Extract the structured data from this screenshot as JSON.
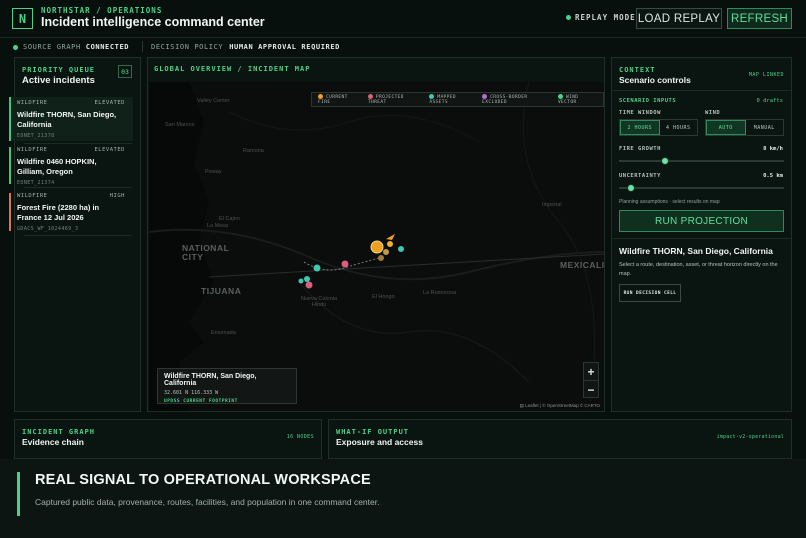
{
  "header": {
    "logo": "N",
    "kicker": "NORTHSTAR / OPERATIONS",
    "title": "Incident intelligence command center",
    "replay_mode": "REPLAY MODE",
    "load_replay": "LOAD REPLAY",
    "refresh": "REFRESH"
  },
  "status": {
    "source_label": "SOURCE GRAPH",
    "source_value": "CONNECTED",
    "policy_label": "DECISION POLICY",
    "policy_value": "HUMAN APPROVAL REQUIRED"
  },
  "queue": {
    "kicker": "PRIORITY QUEUE",
    "title": "Active incidents",
    "count": "03",
    "items": [
      {
        "type": "WILDFIRE",
        "severity": "ELEVATED",
        "name": "Wildfire THORN, San Diego, California",
        "id": "EONET_21378"
      },
      {
        "type": "WILDFIRE",
        "severity": "ELEVATED",
        "name": "Wildfire 0460 HOPKIN, Gilliam, Oregon",
        "id": "EONET_21374"
      },
      {
        "type": "WILDFIRE",
        "severity": "HIGH",
        "name": "Forest Fire (2280 ha) in France 12 Jul 2026",
        "id": "GDACS_WF_1024469_3"
      }
    ]
  },
  "map": {
    "kicker": "GLOBAL OVERVIEW / INCIDENT MAP",
    "legend": [
      {
        "label": "CURRENT FIRE",
        "color": "#f0a020"
      },
      {
        "label": "PROJECTED THREAT",
        "color": "#d9607a"
      },
      {
        "label": "MAPPED ASSETS",
        "color": "#3fc7b0"
      },
      {
        "label": "CROSS-BORDER EXCLUDED",
        "color": "#b070d0"
      },
      {
        "label": "WIND VECTOR",
        "color": "#4bd28a"
      }
    ],
    "labels": {
      "valley_center": "Valley Center",
      "san_marcos": "San Marcos",
      "ramona": "Ramona",
      "poway": "Poway",
      "el_cajon": "El Cajon",
      "la_mesa": "La Mesa",
      "national_city": "NATIONAL CITY",
      "tijuana": "TIJUANA",
      "mexicali": "MEXICALI",
      "imperial": "Imperial",
      "el_hongo": "El Hongo",
      "la_rumorosa": "La Rumorosa",
      "nueva_colonia": "Nueva Colonia Hindú",
      "ensenada": "Ensenada"
    },
    "popup": {
      "title": "Wildfire THORN, San Diego, California",
      "coords": "32.601 N 116.333 W",
      "footprint": "UPDSS CURRENT FOOTPRINT"
    },
    "zoom_in": "+",
    "zoom_out": "−",
    "attribution": "▤ Leaflet | © OpenStreetMap © CARTO"
  },
  "context": {
    "kicker": "CONTEXT",
    "title": "Scenario controls",
    "map_linked": "MAP LINKED",
    "inputs_label": "SCENARIO INPUTS",
    "drafts": "0 drafts",
    "time_window_label": "TIME WINDOW",
    "time_options": [
      "2 HOURS",
      "4 HOURS"
    ],
    "wind_label": "WIND",
    "wind_options": [
      "AUTO",
      "MANUAL"
    ],
    "fire_growth_label": "FIRE GROWTH",
    "fire_growth_value": "8 km/h",
    "fire_growth_fraction": 0.28,
    "uncertainty_label": "UNCERTAINTY",
    "uncertainty_value": "0.5 km",
    "uncertainty_fraction": 0.07,
    "hint": "Planning assumptions · select results on map",
    "run": "RUN PROJECTION",
    "selected_title": "Wildfire THORN, San Diego, California",
    "selected_desc": "Select a route, destination, asset, or threat horizon directly on the map.",
    "run_decision": "RUN DECISION CELL"
  },
  "graph": {
    "kicker": "INCIDENT GRAPH",
    "title": "Evidence chain",
    "nodes": "16 NODES"
  },
  "whatif": {
    "kicker": "WHAT-IF OUTPUT",
    "title": "Exposure and access",
    "tag": "impact-v2-operational"
  },
  "caption": {
    "title": "REAL SIGNAL TO OPERATIONAL WORKSPACE",
    "subtitle": "Captured public data, provenance, routes, facilities, and population in one command center."
  },
  "colors": {
    "accent": "#4bd28a",
    "fire": "#f0a020",
    "threat": "#d9607a",
    "asset": "#3fc7b0",
    "high": "#e0763f"
  }
}
